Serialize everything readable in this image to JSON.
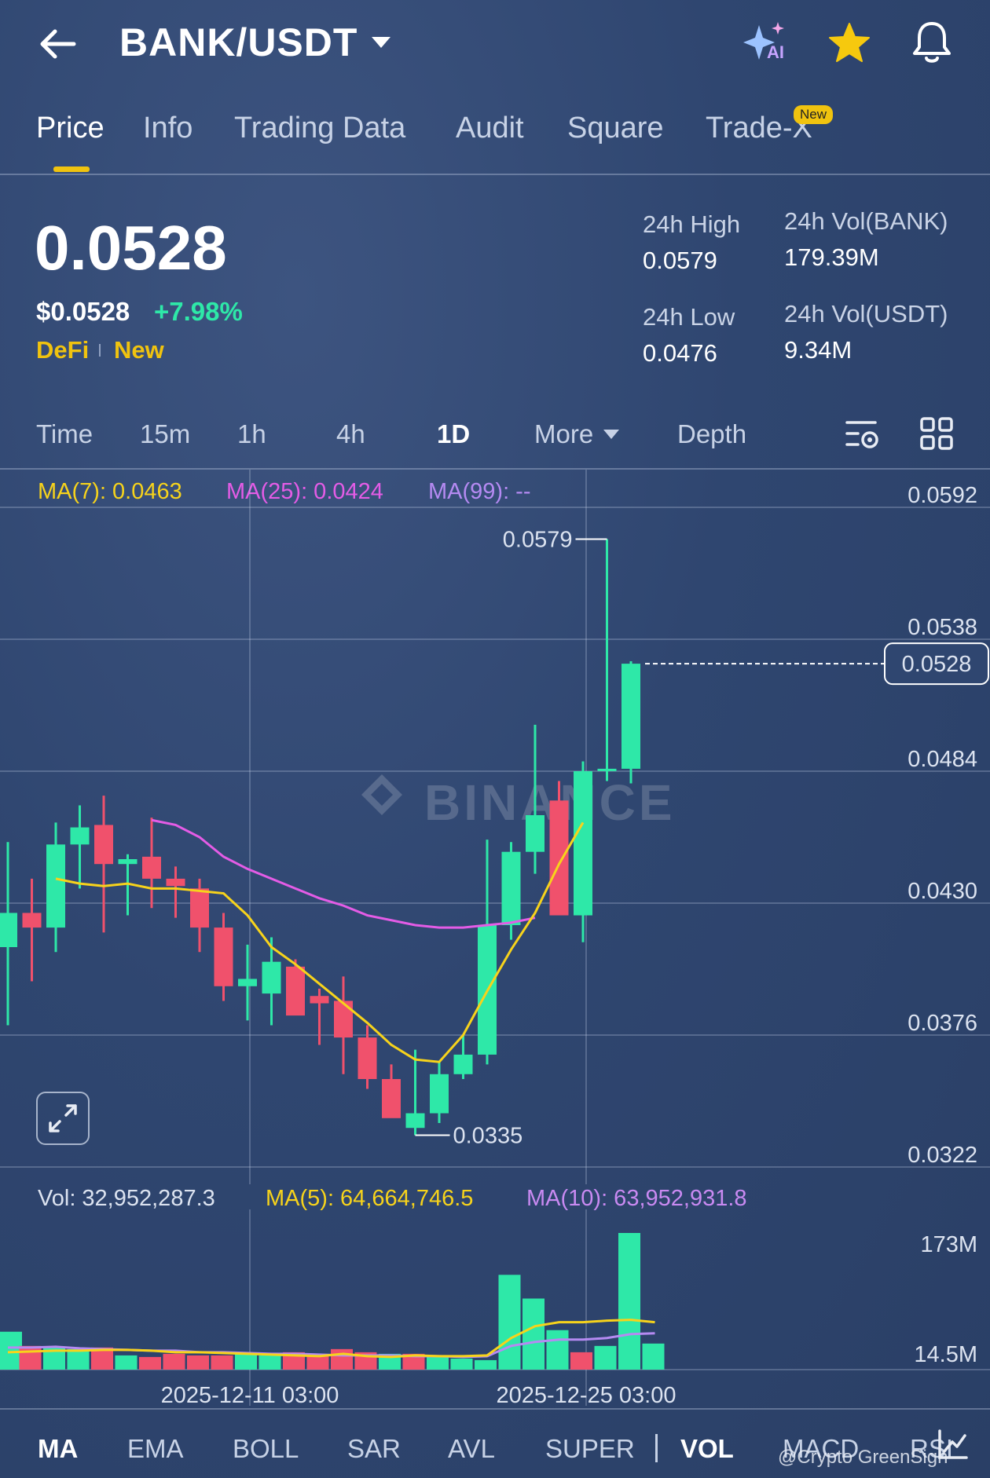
{
  "header": {
    "title": "BANK/USDT",
    "back_icon": "back-arrow-icon",
    "ai_icon": "ai-sparkle-icon",
    "ai_label": "AI",
    "star_icon": "star-icon",
    "bell_icon": "bell-icon"
  },
  "tabs": [
    {
      "label": "Price",
      "active": true
    },
    {
      "label": "Info"
    },
    {
      "label": "Trading Data"
    },
    {
      "label": "Audit"
    },
    {
      "label": "Square"
    },
    {
      "label": "Trade-X",
      "badge": "New"
    }
  ],
  "price": {
    "last": "0.0528",
    "usd": "$0.0528",
    "change": "+7.98%",
    "tag1": "DeFi",
    "tag2": "New"
  },
  "stats": {
    "high_label": "24h High",
    "high_value": "0.0579",
    "low_label": "24h Low",
    "low_value": "0.0476",
    "vol_bank_label": "24h Vol(BANK)",
    "vol_bank_value": "179.39M",
    "vol_usdt_label": "24h Vol(USDT)",
    "vol_usdt_value": "9.34M"
  },
  "timeframes": {
    "time": "Time",
    "m15": "15m",
    "h1": "1h",
    "h4": "4h",
    "d1": "1D",
    "more": "More",
    "depth": "Depth",
    "active": "1D"
  },
  "ma_legend": {
    "ma7": "MA(7): 0.0463",
    "ma25": "MA(25): 0.0424",
    "ma99": "MA(99): --"
  },
  "vol_legend": {
    "vol": "Vol: 32,952,287.3",
    "ma5": "MA(5): 64,664,746.5",
    "ma10": "MA(10): 63,952,931.8"
  },
  "indicators": [
    "MA",
    "EMA",
    "BOLL",
    "SAR",
    "AVL",
    "SUPER",
    "VOL",
    "MACD",
    "RSI"
  ],
  "active_indicators": [
    "MA",
    "VOL"
  ],
  "watermark": "BINANCE",
  "footer_credit": "@Crypto GreenSign",
  "colors": {
    "up": "#2ee8a8",
    "down": "#f0516c",
    "ma7": "#f7d31b",
    "ma25": "#e45ce6",
    "ma99": "#b58af2",
    "accent": "#f0c30f"
  },
  "chart_data": {
    "type": "candlestick",
    "y_ticks": [
      "0.0592",
      "0.0538",
      "0.0484",
      "0.0430",
      "0.0376",
      "0.0322"
    ],
    "ylim": [
      0.0322,
      0.0592
    ],
    "last_price_label": "0.0528",
    "max_label": "0.0579",
    "min_label": "0.0335",
    "x_labels": [
      "2025-12-11 03:00",
      "2025-12-25 03:00"
    ],
    "vol_ticks": [
      "173M",
      "14.5M"
    ],
    "candles": [
      {
        "o": 0.0412,
        "h": 0.0455,
        "l": 0.038,
        "c": 0.0426
      },
      {
        "o": 0.0426,
        "h": 0.044,
        "l": 0.0398,
        "c": 0.042
      },
      {
        "o": 0.042,
        "h": 0.0463,
        "l": 0.041,
        "c": 0.0454
      },
      {
        "o": 0.0454,
        "h": 0.047,
        "l": 0.0436,
        "c": 0.0461
      },
      {
        "o": 0.0462,
        "h": 0.0474,
        "l": 0.0418,
        "c": 0.0446
      },
      {
        "o": 0.0446,
        "h": 0.045,
        "l": 0.0425,
        "c": 0.0448
      },
      {
        "o": 0.0449,
        "h": 0.0465,
        "l": 0.0428,
        "c": 0.044
      },
      {
        "o": 0.044,
        "h": 0.0445,
        "l": 0.0424,
        "c": 0.0437
      },
      {
        "o": 0.0436,
        "h": 0.044,
        "l": 0.041,
        "c": 0.042
      },
      {
        "o": 0.042,
        "h": 0.0426,
        "l": 0.039,
        "c": 0.0396
      },
      {
        "o": 0.0396,
        "h": 0.0413,
        "l": 0.0382,
        "c": 0.0399
      },
      {
        "o": 0.0393,
        "h": 0.0416,
        "l": 0.038,
        "c": 0.0406
      },
      {
        "o": 0.0404,
        "h": 0.0407,
        "l": 0.0396,
        "c": 0.0384
      },
      {
        "o": 0.0392,
        "h": 0.0395,
        "l": 0.0372,
        "c": 0.0389
      },
      {
        "o": 0.039,
        "h": 0.04,
        "l": 0.036,
        "c": 0.0375
      },
      {
        "o": 0.0375,
        "h": 0.038,
        "l": 0.0354,
        "c": 0.0358
      },
      {
        "o": 0.0358,
        "h": 0.0364,
        "l": 0.0344,
        "c": 0.0342
      },
      {
        "o": 0.0338,
        "h": 0.037,
        "l": 0.0335,
        "c": 0.0344
      },
      {
        "o": 0.0344,
        "h": 0.0365,
        "l": 0.034,
        "c": 0.036
      },
      {
        "o": 0.036,
        "h": 0.0376,
        "l": 0.0358,
        "c": 0.0368
      },
      {
        "o": 0.0368,
        "h": 0.0456,
        "l": 0.0364,
        "c": 0.0421
      },
      {
        "o": 0.0421,
        "h": 0.0455,
        "l": 0.0415,
        "c": 0.0451
      },
      {
        "o": 0.0451,
        "h": 0.0503,
        "l": 0.0442,
        "c": 0.0466
      },
      {
        "o": 0.0472,
        "h": 0.048,
        "l": 0.0425,
        "c": 0.0425
      },
      {
        "o": 0.0425,
        "h": 0.0488,
        "l": 0.0414,
        "c": 0.0484
      },
      {
        "o": 0.0485,
        "h": 0.0579,
        "l": 0.048,
        "c": 0.0485
      },
      {
        "o": 0.0485,
        "h": 0.0529,
        "l": 0.0479,
        "c": 0.0528
      }
    ],
    "ma7": [
      0.044,
      0.0438,
      0.0437,
      0.0438,
      0.0436,
      0.0436,
      0.0435,
      0.0434,
      0.0425,
      0.0412,
      0.0405,
      0.0397,
      0.0389,
      0.0381,
      0.0372,
      0.0366,
      0.0365,
      0.0376,
      0.0394,
      0.0411,
      0.0426,
      0.0446,
      0.0463
    ],
    "ma7_start": 2,
    "ma25": [
      0.0464,
      0.0462,
      0.0457,
      0.0449,
      0.0444,
      0.044,
      0.0436,
      0.0432,
      0.0429,
      0.0425,
      0.0423,
      0.0421,
      0.042,
      0.042,
      0.0421,
      0.0422,
      0.0424
    ],
    "ma25_start": 6,
    "volumes": [
      48,
      30,
      28,
      26,
      28,
      18,
      16,
      20,
      18,
      18,
      20,
      18,
      22,
      18,
      26,
      22,
      20,
      20,
      18,
      14,
      12,
      120,
      90,
      50,
      22,
      30,
      173,
      33
    ],
    "vol_up": [
      true,
      false,
      true,
      true,
      false,
      true,
      false,
      false,
      false,
      false,
      true,
      true,
      false,
      false,
      false,
      false,
      true,
      false,
      true,
      true,
      true,
      true,
      true,
      true,
      false,
      true,
      true,
      true
    ],
    "vol_ma5": [
      22,
      23,
      24,
      24,
      25,
      25,
      24,
      22,
      22,
      21,
      20,
      19,
      18,
      17,
      20,
      17,
      16,
      18,
      17,
      17,
      18,
      40,
      55,
      60,
      60,
      62,
      63,
      60
    ],
    "vol_ma10": [
      28,
      28,
      29,
      27,
      26,
      25,
      24,
      24,
      22,
      22,
      21,
      20,
      20,
      19,
      18,
      18,
      18,
      17,
      17,
      16,
      17,
      30,
      35,
      38,
      38,
      40,
      45,
      46
    ]
  }
}
